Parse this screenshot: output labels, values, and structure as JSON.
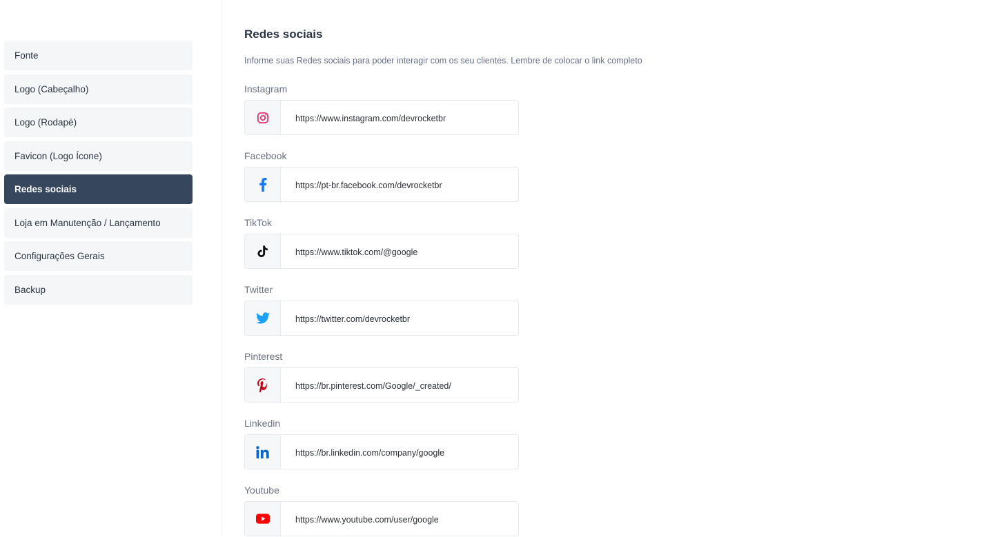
{
  "sidebar": {
    "items": [
      {
        "label": "Fonte",
        "active": false
      },
      {
        "label": "Logo (Cabeçalho)",
        "active": false
      },
      {
        "label": "Logo (Rodapé)",
        "active": false
      },
      {
        "label": "Favicon (Logo Ícone)",
        "active": false
      },
      {
        "label": "Redes sociais",
        "active": true
      },
      {
        "label": "Loja em Manutenção / Lançamento",
        "active": false
      },
      {
        "label": "Configurações Gerais",
        "active": false
      },
      {
        "label": "Backup",
        "active": false
      }
    ]
  },
  "main": {
    "title": "Redes sociais",
    "description": "Informe suas Redes sociais para poder interagir com os seu clientes. Lembre de colocar o link completo",
    "fields": [
      {
        "label": "Instagram",
        "icon": "instagram-icon",
        "value": "https://www.instagram.com/devrocketbr",
        "color": "#e1306c"
      },
      {
        "label": "Facebook",
        "icon": "facebook-icon",
        "value": "https://pt-br.facebook.com/devrocketbr",
        "color": "#1877f2"
      },
      {
        "label": "TikTok",
        "icon": "tiktok-icon",
        "value": "https://www.tiktok.com/@google",
        "color": "#000000"
      },
      {
        "label": "Twitter",
        "icon": "twitter-icon",
        "value": "https://twitter.com/devrocketbr",
        "color": "#1da1f2"
      },
      {
        "label": "Pinterest",
        "icon": "pinterest-icon",
        "value": "https://br.pinterest.com/Google/_created/",
        "color": "#bd081c"
      },
      {
        "label": "Linkedin",
        "icon": "linkedin-icon",
        "value": "https://br.linkedin.com/company/google",
        "color": "#0a66c2"
      },
      {
        "label": "Youtube",
        "icon": "youtube-icon",
        "value": "https://www.youtube.com/user/google",
        "color": "#ff0000"
      }
    ]
  },
  "colors": {
    "sidebar_active_bg": "#35465d",
    "sidebar_item_bg": "#f4f6f8"
  }
}
